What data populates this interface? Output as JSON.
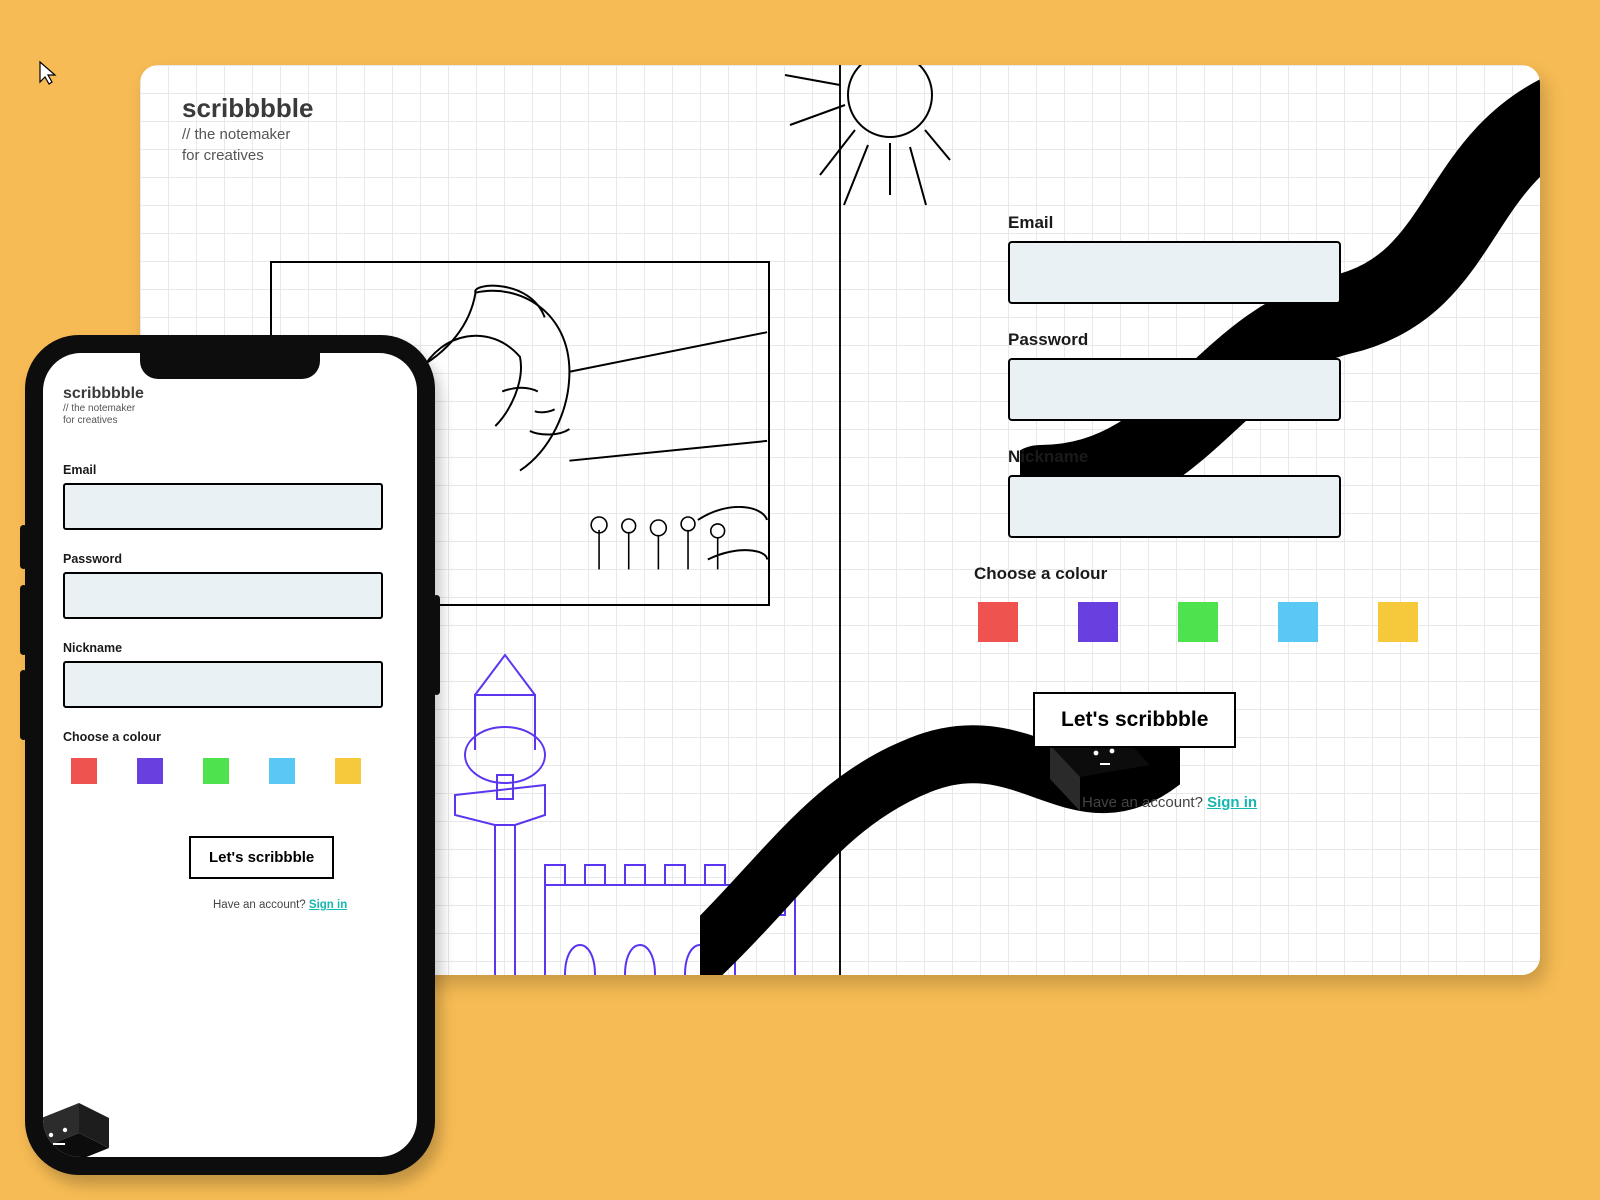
{
  "brand": {
    "name": "scribbbble",
    "tagline1": "// the notemaker",
    "tagline2": "for creatives"
  },
  "form": {
    "email_label": "Email",
    "password_label": "Password",
    "nickname_label": "Nickname",
    "colour_label": "Choose a colour",
    "cta_label": "Let's scribbble",
    "have_account_text": "Have an account? ",
    "signin_label": "Sign in"
  },
  "colours": {
    "red": "#ef5350",
    "purple": "#6a3fe0",
    "green": "#4fe24f",
    "blue": "#5ac8f5",
    "yellow": "#f5c93b"
  }
}
